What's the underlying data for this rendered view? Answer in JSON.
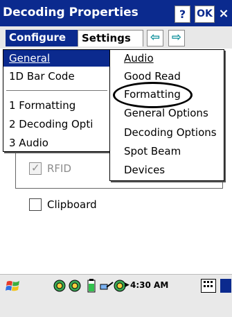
{
  "window": {
    "title": "Decoding Properties",
    "help_label": "?",
    "ok_label": "OK",
    "close_label": "×"
  },
  "tabs": {
    "configure": "Configure",
    "settings": "Settings",
    "scroll_left": "⇦",
    "scroll_right": "⇨"
  },
  "configure_menu": {
    "items": [
      {
        "text": "General",
        "selected": true
      },
      {
        "text": "1D Bar Code"
      },
      {
        "text": "1 Formatting"
      },
      {
        "text": "2 Decoding Opti"
      },
      {
        "text": "3 Audio"
      }
    ]
  },
  "settings_menu": {
    "items": [
      {
        "text": "Audio"
      },
      {
        "text": "Good Read"
      },
      {
        "text": "Formatting",
        "highlighted": true
      },
      {
        "text": "General Options"
      },
      {
        "text": "Decoding Options"
      },
      {
        "text": "Spot Beam"
      },
      {
        "text": "Devices"
      }
    ]
  },
  "background": {
    "rfid_label": "RFID",
    "rfid_checked": true,
    "clipboard_label": "Clipboard",
    "clipboard_checked": false
  },
  "taskbar": {
    "time": "4:30 AM"
  },
  "colors": {
    "titlebar": "#0b2a8e",
    "selection": "#0b2a8e",
    "taskbar": "#e9e9e9"
  }
}
